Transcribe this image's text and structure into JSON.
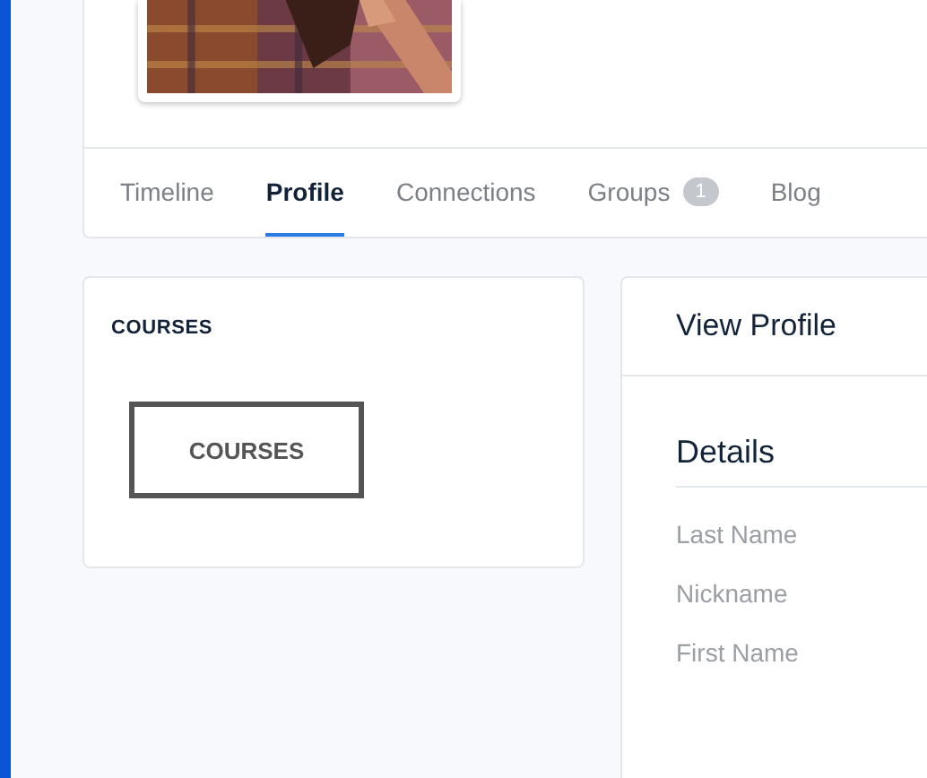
{
  "tabs": [
    {
      "label": "Timeline",
      "selected": false
    },
    {
      "label": "Profile",
      "selected": true
    },
    {
      "label": "Connections",
      "selected": false
    },
    {
      "label": "Groups",
      "selected": false,
      "badge": "1"
    },
    {
      "label": "Blog",
      "selected": false
    }
  ],
  "courses_widget": {
    "title": "COURSES",
    "button": "COURSES"
  },
  "view_profile": {
    "title": "View Profile",
    "section": "Details",
    "fields": [
      "Last Name",
      "Nickname",
      "First Name"
    ]
  }
}
